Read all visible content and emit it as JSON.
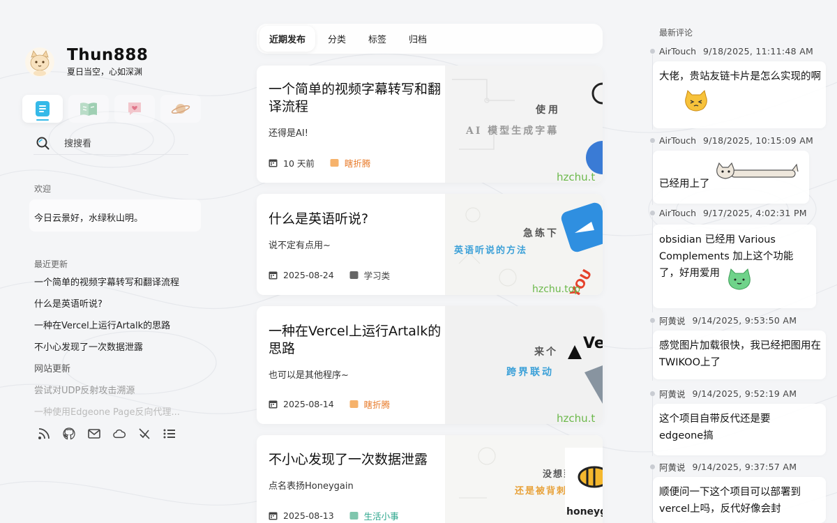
{
  "site": {
    "name": "Thun888",
    "motto": "夏日当空，心如深渊"
  },
  "sidebar": {
    "nav_icons": [
      "article-icon",
      "book-icon",
      "heart-chat-icon",
      "planet-icon"
    ],
    "search_placeholder": "搜搜看",
    "welcome_title": "欢迎",
    "welcome_text": "今日云景好，水绿秋山明。",
    "recent_title": "最近更新",
    "recent_items": [
      "一个简单的视频字幕转写和翻译流程",
      "什么是英语听说?",
      "一种在Vercel上运行Artalk的思路",
      "不小心发现了一次数据泄露",
      "网站更新",
      "尝试对UDP反射攻击溯源",
      "一种使用Edgeone Page反向代理..."
    ],
    "social_icons": [
      "rss-icon",
      "github-icon",
      "mail-icon",
      "cloud-icon",
      "no-tracking-icon",
      "list-icon"
    ]
  },
  "tabs": [
    "近期发布",
    "分类",
    "标签",
    "归档"
  ],
  "posts": [
    {
      "title": "一个简单的视频字幕转写和翻译流程",
      "desc": "还得是AI!",
      "date": "10 天前",
      "category": "瞎折腾",
      "cover_lines": [
        "使用",
        "AI 模型生成字幕"
      ],
      "cover_brand": "hzchu.t"
    },
    {
      "title": "什么是英语听说?",
      "desc": "说不定有点用~",
      "date": "2025-08-24",
      "category": "学习类",
      "cover_lines": [
        "急练下",
        "英语听说的方法"
      ],
      "cover_brand": "hzchu.top"
    },
    {
      "title": "一种在Vercel上运行Artalk的思路",
      "desc": "也可以是其他程序~",
      "date": "2025-08-14",
      "category": "瞎折腾",
      "cover_lines": [
        "来个",
        "跨界联动"
      ],
      "cover_brand": "hzchu.t"
    },
    {
      "title": "不小心发现了一次数据泄露",
      "desc": "点名表扬Honeygain",
      "date": "2025-08-13",
      "category": "生活小事",
      "cover_lines": [
        "没想到",
        "还是被背刺了"
      ],
      "cover_brand": "honeyga"
    }
  ],
  "comments": {
    "title": "最新评论",
    "items": [
      {
        "author": "AirTouch",
        "time": "9/18/2025, 11:11:48 AM",
        "text": "大佬，贵站友链卡片是怎么实现的啊"
      },
      {
        "author": "AirTouch",
        "time": "9/18/2025, 10:15:09 AM",
        "text": "已经用上了"
      },
      {
        "author": "AirTouch",
        "time": "9/17/2025, 4:02:31 PM",
        "text": "obsidian 已经用 Various Complements 加上这个功能了，好用爱用"
      },
      {
        "author": "阿黄说",
        "time": "9/14/2025, 9:53:50 AM",
        "text": "感觉图片加载很快，我已经把图用在TWIKOO上了"
      },
      {
        "author": "阿黄说",
        "time": "9/14/2025, 9:52:19 AM",
        "text": "这个项目自带反代还是要edgeone搞"
      },
      {
        "author": "阿黄说",
        "time": "9/14/2025, 9:37:57 AM",
        "text": "顺便问一下这个项目可以部署到vercel上吗，反代好像会封"
      }
    ]
  },
  "colors": {
    "accent": "#35b9e8",
    "category_orange": "#e87c2c",
    "category_green": "#2aa58b"
  }
}
